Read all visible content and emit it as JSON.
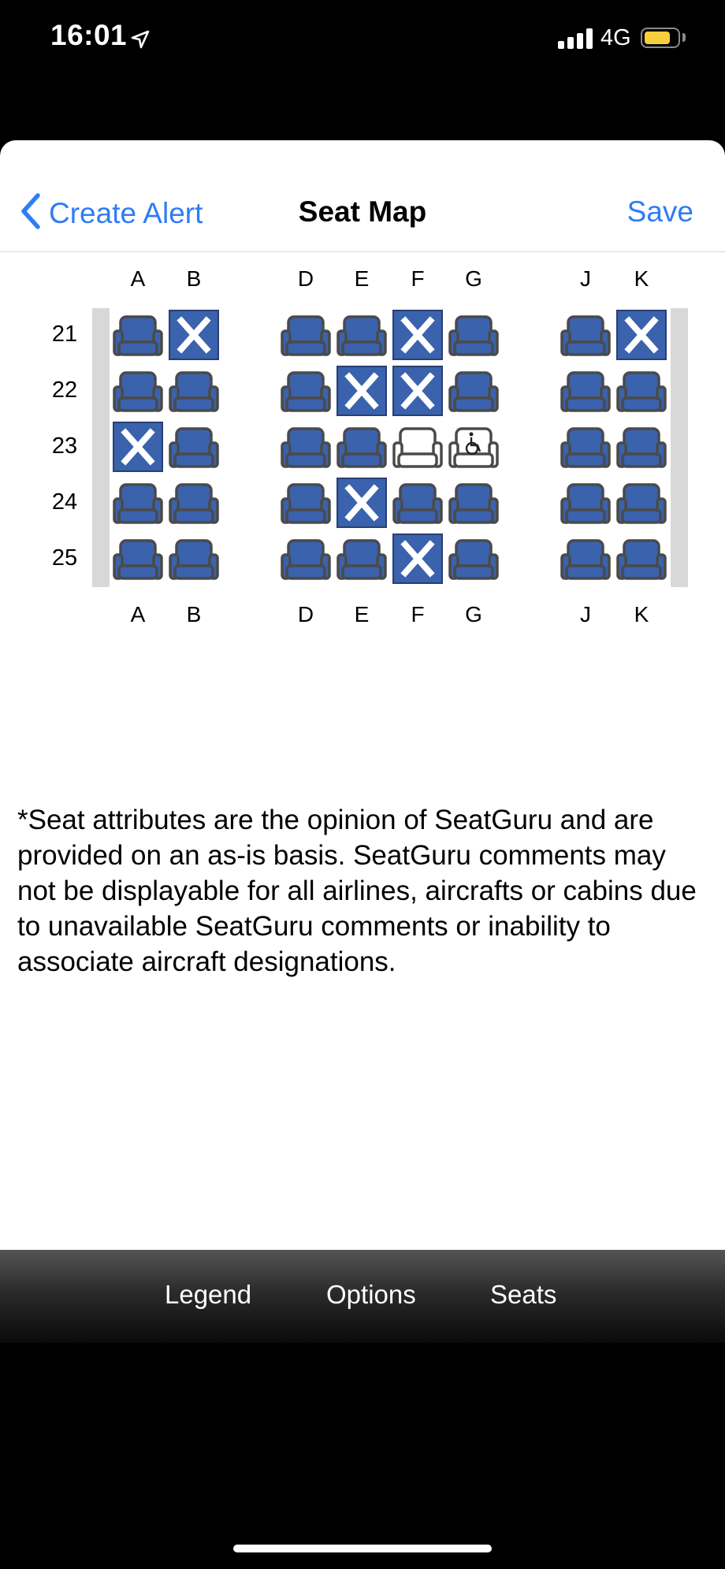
{
  "status_bar": {
    "time": "16:01",
    "network": "4G"
  },
  "nav": {
    "back_label": "Create Alert",
    "title": "Seat Map",
    "save_label": "Save"
  },
  "seat_map": {
    "columns": [
      "A",
      "B",
      "D",
      "E",
      "F",
      "G",
      "J",
      "K"
    ],
    "rows": [
      {
        "number": "21",
        "seats": [
          "available",
          "occupied",
          "available",
          "available",
          "occupied",
          "available",
          "available",
          "occupied"
        ]
      },
      {
        "number": "22",
        "seats": [
          "available",
          "available",
          "available",
          "occupied",
          "occupied",
          "available",
          "available",
          "available"
        ]
      },
      {
        "number": "23",
        "seats": [
          "occupied",
          "available",
          "available",
          "available",
          "blocked",
          "accessible",
          "available",
          "available"
        ]
      },
      {
        "number": "24",
        "seats": [
          "available",
          "available",
          "available",
          "occupied",
          "available",
          "available",
          "available",
          "available"
        ]
      },
      {
        "number": "25",
        "seats": [
          "available",
          "available",
          "available",
          "available",
          "occupied",
          "available",
          "available",
          "available"
        ]
      }
    ]
  },
  "disclaimer": "*Seat attributes are the opinion of SeatGuru and are provided on an as-is basis. SeatGuru comments may not be displayable for all airlines, aircrafts or cabins due to unavailable SeatGuru comments or inability to associate aircraft designations.",
  "toolbar": {
    "legend_label": "Legend",
    "options_label": "Options",
    "seats_label": "Seats"
  },
  "colors": {
    "accent": "#2f7cf6",
    "seat_fill": "#3a62ad",
    "seat_outline": "#4a4a4a",
    "battery": "#f7cf3d"
  }
}
